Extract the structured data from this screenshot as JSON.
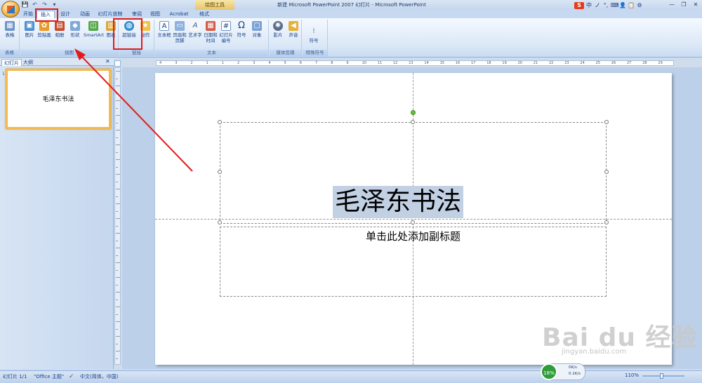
{
  "window": {
    "title": "新建 Microsoft PowerPoint 2007 幻灯片 - Microsoft PowerPoint",
    "context_tab": "绘图工具"
  },
  "qat": {
    "save": "💾",
    "undo": "↶",
    "redo": "↷",
    "more": "▾"
  },
  "tray": [
    "中",
    "ノ",
    "°,",
    "⌨",
    "👤",
    "📋",
    "⚙"
  ],
  "tray_logo": "S",
  "win_controls": [
    "—",
    "❐",
    "✕"
  ],
  "tabs": {
    "home": "开始",
    "insert": "插入",
    "design": "设计",
    "animation": "动画",
    "slideshow": "幻灯片放映",
    "review": "审阅",
    "view": "视图",
    "acrobat": "Acrobat",
    "format": "格式"
  },
  "ribbon": {
    "groups": {
      "tables": "表格",
      "illustrations": "插图",
      "links": "链接",
      "text": "文本",
      "media": "媒体剪辑",
      "symbols": "特殊符号"
    },
    "buttons": {
      "table": "表格",
      "picture": "图片",
      "clipart": "剪贴画",
      "album": "相册",
      "shapes": "形状",
      "smartart": "SmartArt",
      "chart": "图表",
      "hyperlink": "超链接",
      "action": "动作",
      "textbox": "文本框",
      "headerfooter": "页眉和页脚",
      "wordart": "艺术字",
      "datetime": "日期和时间",
      "slidenum": "幻灯片编号",
      "symbol": "符号",
      "object": "对象",
      "movie": "影片",
      "sound": "声音",
      "special": "符号"
    }
  },
  "pane": {
    "tab_slides": "幻灯片",
    "tab_outline": "大纲",
    "close": "✕",
    "slide_number": "1",
    "thumb_title": "毛泽东书法"
  },
  "slide": {
    "title": "毛泽东书法",
    "subtitle_placeholder": "单击此处添加副标题"
  },
  "status": {
    "slide_counter": "幻灯片 1/1",
    "theme": "\"Office 主题\"",
    "language": "中文(简体，中国)",
    "zoom": "110%"
  },
  "net": {
    "percent": "18%",
    "up": "0K/s",
    "down": "0.1K/s"
  },
  "watermark": {
    "brand": "Bai du 经验",
    "url": "jingyan.baidu.com"
  },
  "ruler": {
    "labels": [
      "4",
      "3",
      "2",
      "1",
      "1",
      "2",
      "3",
      "4",
      "5",
      "6",
      "7",
      "8",
      "9",
      "10",
      "11",
      "12",
      "13",
      "14",
      "15",
      "16",
      "17",
      "18",
      "19",
      "20",
      "21",
      "22",
      "23",
      "24",
      "25",
      "26",
      "27",
      "28",
      "29"
    ]
  }
}
